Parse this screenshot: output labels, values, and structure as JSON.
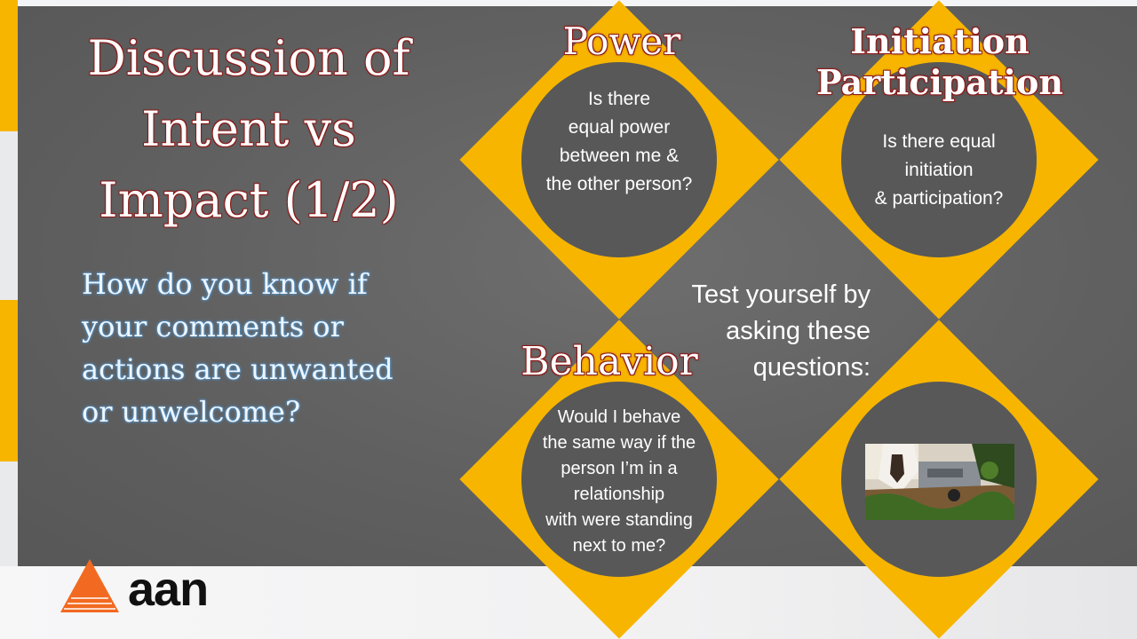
{
  "slide": {
    "title": "Discussion of\nIntent vs\nImpact (1/2)",
    "question": "How do you know if\nyour comments or\nactions are unwanted\nor unwelcome?",
    "test_prompt": "Test yourself by\nasking these\nquestions:"
  },
  "diamonds": {
    "power": {
      "heading": "Power",
      "text": "Is there\nequal power\nbetween me &\nthe other person?"
    },
    "initiation": {
      "heading": "Initiation\nParticipation",
      "text": "Is there equal\ninitiation\n& participation?"
    },
    "behavior": {
      "heading": "Behavior",
      "text": "Would I behave\nthe same way if the\nperson I’m in a\nrelationship\nwith were standing\nnext to me?"
    },
    "photo": {
      "icon": "photo-image"
    }
  },
  "logo": {
    "text": "aan",
    "icon": "triangle-logo-icon"
  },
  "colors": {
    "accent": "#f7b500",
    "panel": "#606060",
    "circle": "#585858",
    "heading_outline": "#8b1a1a",
    "question_glow": "#5aa8e8"
  }
}
